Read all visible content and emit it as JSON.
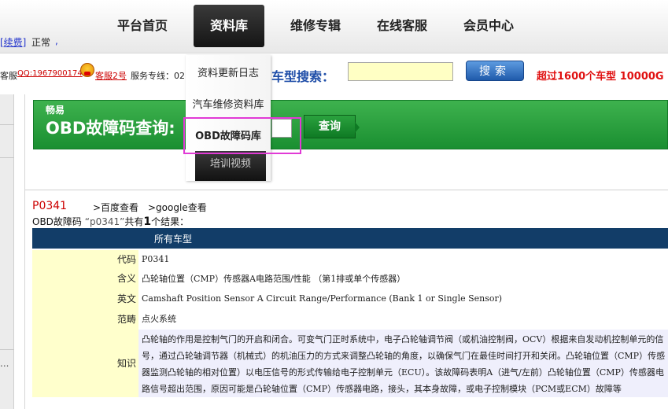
{
  "nav": {
    "items": [
      "平台首页",
      "资料库",
      "维修专辑",
      "在线客服",
      "会员中心"
    ],
    "active_index": 1
  },
  "account": {
    "renew_link": "[续费]",
    "status": "正常",
    "extra_link": ","
  },
  "contact": {
    "prefix": "客服",
    "qq_link": "QQ:1967900174",
    "kefu_link": "客服2号",
    "hotline": "服务专线：02"
  },
  "search": {
    "label": "车型搜索：",
    "input_value": "",
    "button": "搜索",
    "promo": "超过1600个车型  10000G"
  },
  "dropdown": {
    "items": [
      "资料更新日志",
      "汽车维修资料库",
      "OBD故障码库",
      "培训视频"
    ],
    "highlighted_index": 2
  },
  "banner": {
    "brand": "畅易",
    "title": "OBD故障码查询:",
    "input_value": "",
    "button": "查询"
  },
  "result": {
    "code": "P0341",
    "baidu_link": ">百度查看",
    "google_link": ">google查看",
    "summary_prefix": "OBD故障码",
    "summary_code": "“p0341”",
    "summary_mid": "共有",
    "summary_count": "1",
    "summary_suffix": "个结果：",
    "table_header": "所有车型",
    "rows": [
      {
        "label": "代码",
        "value": "P0341"
      },
      {
        "label": "含义",
        "value": "凸轮轴位置（CMP）传感器A电路范围/性能 （第1排或单个传感器）"
      },
      {
        "label": "英文",
        "value": "Camshaft Position Sensor A Circuit Range/Performance (Bank 1 or Single Sensor)"
      },
      {
        "label": "范畴",
        "value": "点火系统"
      },
      {
        "label": "知识",
        "value": "凸轮轴的作用是控制气门的开启和闭合。可变气门正时系统中，电子凸轮轴调节阀（或机油控制阀，OCV）根据来自发动机控制单元的信号，通过凸轮轴调节器（机械式）的机油压力的方式来调整凸轮轴的角度，以确保气门在最佳时间打开和关闭。凸轮轴位置（CMP）传感器监测凸轮轴的相对位置）以电压信号的形式传输给电子控制单元（ECU）。该故障码表明A（进气/左前）凸轮轴位置（CMP）传感器电路信号超出范围，原因可能是凸轮轴位置（CMP）传感器电路，接头，其本身故障，或电子控制模块（PCM或ECM）故障等"
      }
    ]
  },
  "sidebar": {
    "dots": "..."
  }
}
